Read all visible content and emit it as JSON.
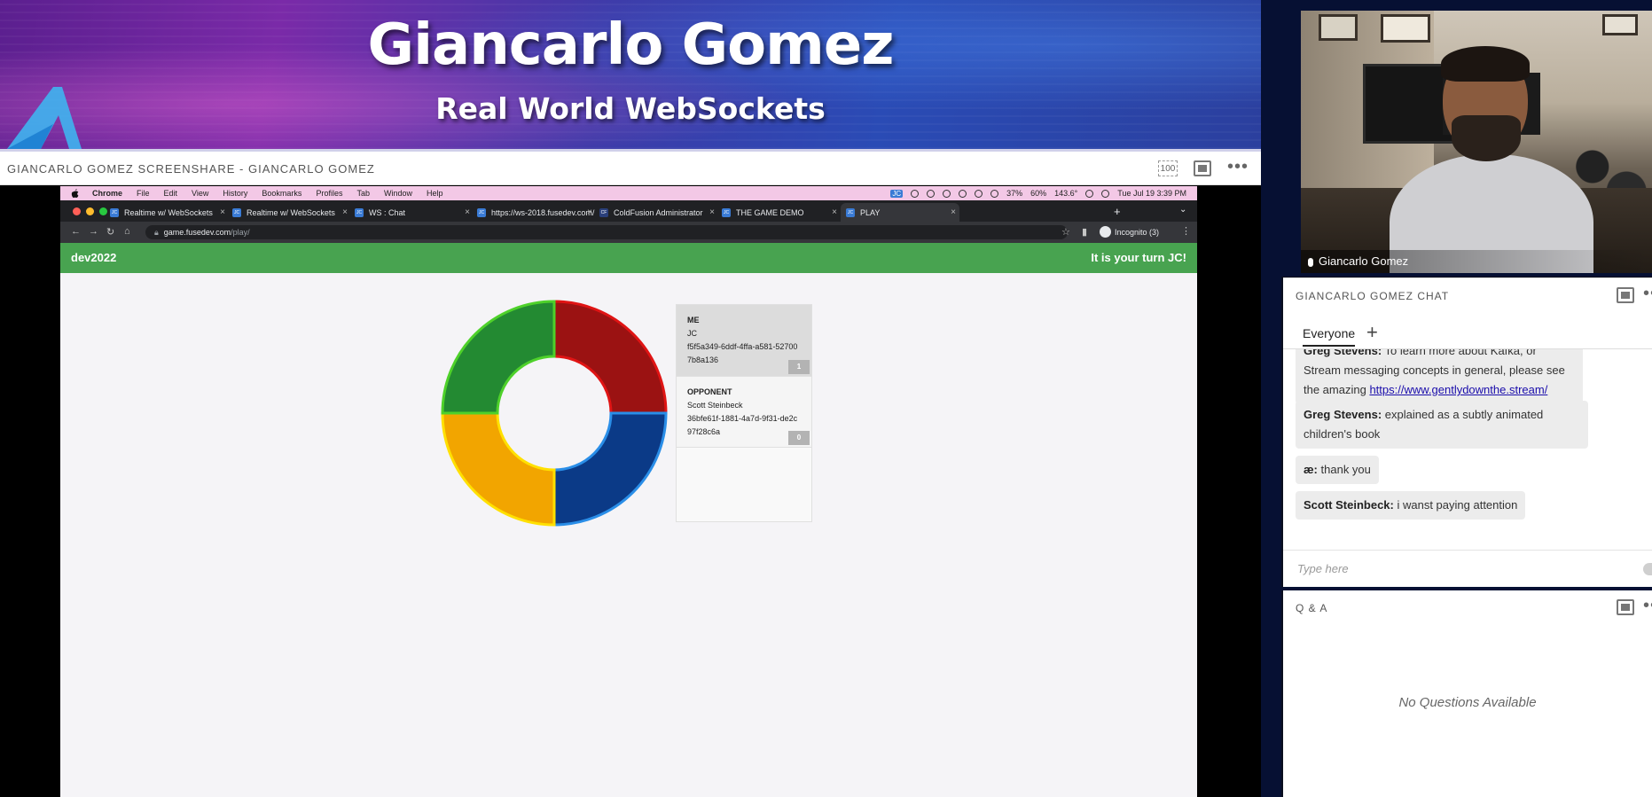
{
  "banner": {
    "title": "Giancarlo Gomez",
    "subtitle": "Real World WebSockets"
  },
  "screenshare": {
    "title": "GIANCARLO GOMEZ SCREENSHARE  - GIANCARLO GOMEZ",
    "zoom_label": "100"
  },
  "mac_menu": {
    "app": "Chrome",
    "items": [
      "File",
      "Edit",
      "View",
      "History",
      "Bookmarks",
      "Profiles",
      "Tab",
      "Window",
      "Help"
    ],
    "status": {
      "badge": "JC",
      "cpu": "37%",
      "battery": "60%",
      "temp": "143.6°",
      "clock": "Tue Jul 19  3:39 PM"
    }
  },
  "browser": {
    "tabs": [
      {
        "label": "Realtime w/ WebSockets",
        "icon": "jc-favicon"
      },
      {
        "label": "Realtime w/ WebSockets",
        "icon": "jc-favicon"
      },
      {
        "label": "WS : Chat",
        "icon": "jc-favicon"
      },
      {
        "label": "https://ws-2018.fusedev.com/",
        "icon": "jc-favicon"
      },
      {
        "label": "ColdFusion Administrator",
        "icon": "cf-favicon"
      },
      {
        "label": "THE GAME DEMO",
        "icon": "jc-favicon"
      },
      {
        "label": "PLAY",
        "icon": "jc-favicon"
      }
    ],
    "url_host": "game.fusedev.com",
    "url_path": "/play/",
    "incognito_label": "Incognito (3)"
  },
  "game": {
    "brand": "dev2022",
    "turn_message": "It is your turn JC!",
    "donut_colors": {
      "red": "#9b1212",
      "blue": "#0b3a87",
      "yellow": "#f2a500",
      "green": "#238a32"
    },
    "players": [
      {
        "role": "ME",
        "name": "JC",
        "uuid": "f5f5a349-6ddf-4ffa-a581-527007b8a136",
        "score": "1"
      },
      {
        "role": "OPPONENT",
        "name": "Scott Steinbeck",
        "uuid": "36bfe61f-1881-4a7d-9f31-de2c97f28c6a",
        "score": "0"
      }
    ]
  },
  "camera": {
    "name": "Giancarlo Gomez"
  },
  "chat": {
    "title": "GIANCARLO GOMEZ CHAT",
    "tab": "Everyone",
    "messages": [
      {
        "author": "Greg Stevens:",
        "text": "To learn more about Kafka, or Stream messaging concepts in general, please see the amazing ",
        "link": "https://www.gentlydownthe.stream/"
      },
      {
        "author": "Greg Stevens:",
        "text": "explained as a subtly animated children's book"
      },
      {
        "author": "æ:",
        "text": "thank you"
      },
      {
        "author": "Scott Steinbeck:",
        "text": "i wanst paying attention"
      }
    ],
    "input_placeholder": "Type here"
  },
  "qa": {
    "title": "Q & A",
    "empty_text": "No Questions Available"
  }
}
